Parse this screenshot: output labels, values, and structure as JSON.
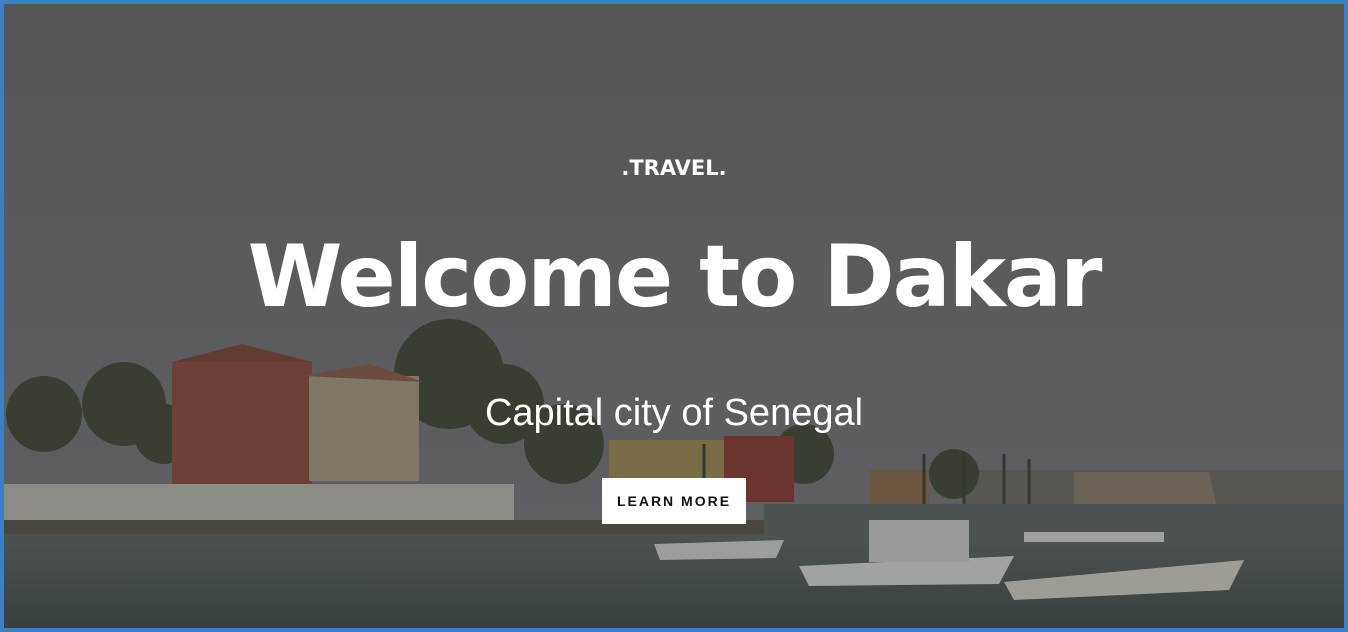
{
  "hero": {
    "brand": ".TRAVEL.",
    "headline": "Welcome to Dakar",
    "subtitle": "Capital city of Senegal",
    "cta_label": "LEARN MORE"
  },
  "colors": {
    "frame_border": "#3b7fc4",
    "sky": "#6e6e72",
    "sea": "#4a5552",
    "text": "#ffffff",
    "button_bg": "#ffffff",
    "button_text": "#111111"
  }
}
